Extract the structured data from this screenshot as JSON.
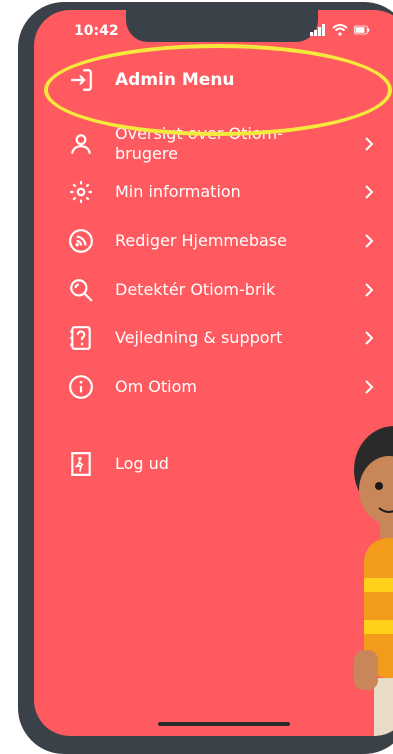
{
  "status_bar": {
    "time": "10:42"
  },
  "header": {
    "title": "Admin Menu"
  },
  "menu": {
    "items": [
      {
        "label": "Oversigt over Otiom-\nbrugere",
        "icon": "user-icon"
      },
      {
        "label": "Min information",
        "icon": "gear-icon"
      },
      {
        "label": "Rediger Hjemmebase",
        "icon": "home-signal-icon"
      },
      {
        "label": "Detektér Otiom-brik",
        "icon": "search-icon"
      },
      {
        "label": "Vejledning & support",
        "icon": "help-book-icon"
      },
      {
        "label": "Om Otiom",
        "icon": "info-icon"
      }
    ],
    "logout_label": "Log ud"
  },
  "colors": {
    "screen_bg": "#ff5a5f",
    "frame": "#3b4148",
    "highlight": "#f5ea3b",
    "text": "#ffffff"
  }
}
